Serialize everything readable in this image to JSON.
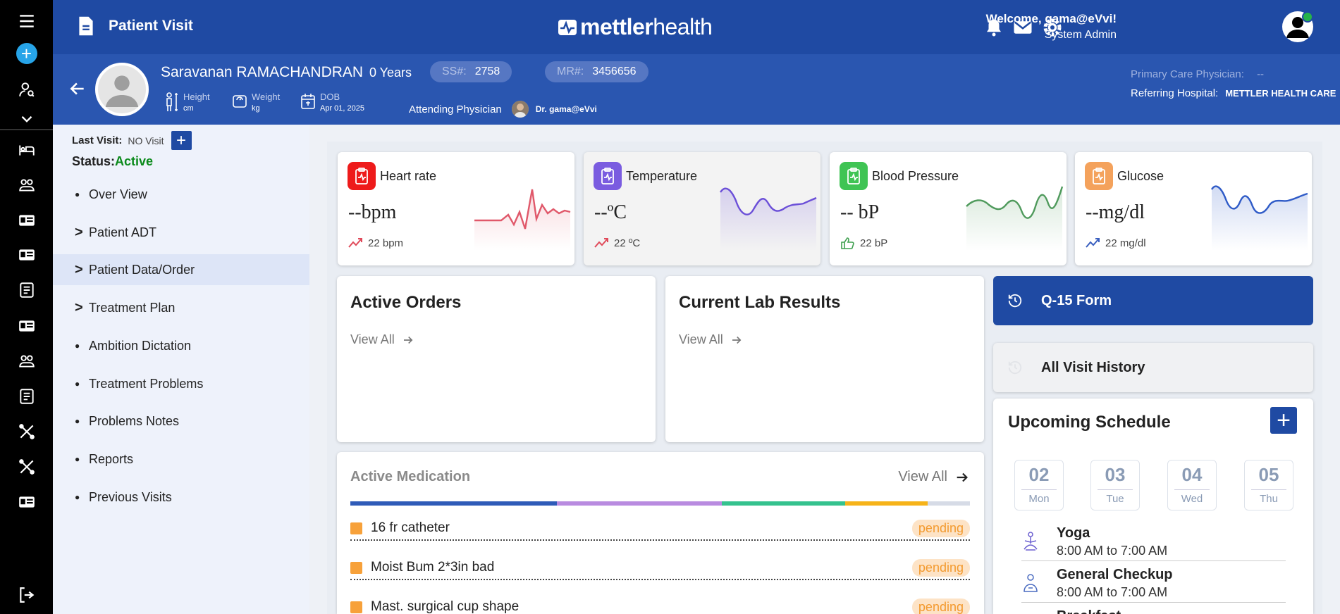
{
  "header": {
    "page_title": "Patient Visit",
    "brand_bold": "mettler",
    "brand_light": "health",
    "welcome": "Welcome, gama@eVvi!",
    "role": "System Admin"
  },
  "patient": {
    "name": "Saravanan RAMACHANDRAN",
    "age": "0 Years",
    "ss_label": "SS#:",
    "ss_value": "2758",
    "mr_label": "MR#:",
    "mr_value": "3456656",
    "height_label": "Height",
    "height_unit": "cm",
    "weight_label": "Weight",
    "weight_unit": "kg",
    "dob_label": "DOB",
    "dob_value": "Apr 01, 2025",
    "attending_label": "Attending Physician",
    "attending_name": "Dr. gama@eVvi",
    "pcp_label": "Primary Care Physician:",
    "pcp_value": "--",
    "referring_label": "Referring Hospital:",
    "referring_value": "METTLER HEALTH CARE"
  },
  "sidebar": {
    "last_visit_label": "Last Visit:",
    "last_visit_value": "NO Visit",
    "add_label": "+",
    "status_label": "Status:",
    "status_value": "Active",
    "items": [
      {
        "label": "Over View",
        "marker": "●"
      },
      {
        "label": "Patient ADT",
        "marker": ">"
      },
      {
        "label": "Patient Data/Order",
        "marker": ">"
      },
      {
        "label": "Treatment Plan",
        "marker": ">"
      },
      {
        "label": "Ambition Dictation",
        "marker": "●"
      },
      {
        "label": "Treatment Problems",
        "marker": "●"
      },
      {
        "label": "Problems Notes",
        "marker": "●"
      },
      {
        "label": "Reports",
        "marker": "●"
      },
      {
        "label": "Previous Visits",
        "marker": "●"
      }
    ],
    "selected_index": 2
  },
  "vitals": [
    {
      "title": "Heart rate",
      "value": "--bpm",
      "trend": "22 bpm",
      "color": "#ee1b1b",
      "line": "#e0586a"
    },
    {
      "title": "Temperature",
      "value": "--ºC",
      "trend": "22 ºC",
      "color": "#7a5ce0",
      "line": "#6b4fd8"
    },
    {
      "title": "Blood Pressure",
      "value": "-- bP",
      "trend": "22 bP",
      "color": "#3fc454",
      "line": "#4f9a5c"
    },
    {
      "title": "Glucose",
      "value": "--mg/dl",
      "trend": "22 mg/dl",
      "color": "#f4a25c",
      "line": "#2f5bc7"
    }
  ],
  "orders": {
    "title": "Active Orders",
    "view_all": "View All"
  },
  "labs": {
    "title": "Current Lab Results",
    "view_all": "View All"
  },
  "qform": {
    "label": "Q-15 Form"
  },
  "history": {
    "label": "All Visit History"
  },
  "schedule": {
    "title": "Upcoming Schedule",
    "add_label": "+",
    "days": [
      {
        "num": "02",
        "name": "Mon"
      },
      {
        "num": "03",
        "name": "Tue"
      },
      {
        "num": "04",
        "name": "Wed"
      },
      {
        "num": "05",
        "name": "Thu"
      }
    ],
    "events": [
      {
        "title": "Yoga",
        "time": "8:00 AM to 7:00 AM"
      },
      {
        "title": "General Checkup",
        "time": "8:00 AM to 7:00 AM"
      },
      {
        "title": "Breakfast",
        "time": ""
      }
    ]
  },
  "medication": {
    "title": "Active Medication",
    "view_all": "View All",
    "bar_segments": [
      {
        "color": "#2f5bb8",
        "share": 0.333
      },
      {
        "color": "#b98be0",
        "share": 0.266
      },
      {
        "color": "#35c28e",
        "share": 0.2
      },
      {
        "color": "#f6b319",
        "share": 0.133
      },
      {
        "color": "#d6dbe6",
        "share": 0.068
      }
    ],
    "items": [
      {
        "name": "16 fr catheter",
        "status": "pending"
      },
      {
        "name": "Moist Bum 2*3in bad",
        "status": "pending"
      },
      {
        "name": "Mast. surgical cup shape",
        "status": "pending"
      }
    ]
  }
}
